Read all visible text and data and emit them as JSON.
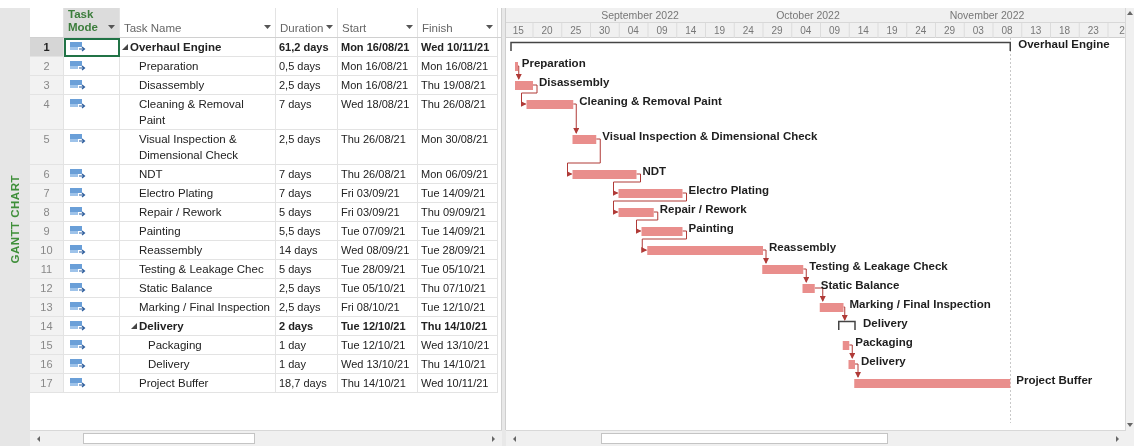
{
  "side_label": "GANTT CHART",
  "columns": [
    "Task Mode",
    "Task Name",
    "Duration",
    "Start",
    "Finish"
  ],
  "timescale": {
    "months": [
      "September 2022",
      "October 2022",
      "November 2022"
    ],
    "days": [
      "15",
      "20",
      "25",
      "30",
      "04",
      "09",
      "14",
      "19",
      "24",
      "29",
      "04",
      "09",
      "14",
      "19",
      "24",
      "29",
      "03",
      "08",
      "13",
      "18",
      "23",
      "2"
    ]
  },
  "rows": [
    {
      "id": "1",
      "name": "Overhaul Engine",
      "kind": "summary",
      "expanded": true,
      "selected": true,
      "duration": "61,2 days",
      "start": "Mon 16/08/21",
      "finish": "Wed 10/11/21",
      "bar_label": "Overhaul Engine",
      "children": [
        {
          "id": "2",
          "name": "Preparation",
          "kind": "task",
          "selected": false,
          "duration": "0,5 days",
          "start": "Mon 16/08/21",
          "finish": "Mon 16/08/21",
          "bar_label": "Preparation"
        },
        {
          "id": "3",
          "name": "Disassembly",
          "kind": "task",
          "selected": false,
          "duration": "2,5 days",
          "start": "Mon 16/08/21",
          "finish": "Thu 19/08/21",
          "bar_label": "Disassembly"
        },
        {
          "id": "4",
          "name": "Cleaning & Removal Paint",
          "kind": "task",
          "selected": false,
          "duration": "7 days",
          "start": "Wed 18/08/21",
          "finish": "Thu 26/08/21",
          "bar_label": "Cleaning & Removal Paint"
        },
        {
          "id": "5",
          "name": "Visual Inspection & Dimensional Check",
          "kind": "task",
          "selected": false,
          "duration": "2,5 days",
          "start": "Thu 26/08/21",
          "finish": "Mon 30/08/21",
          "bar_label": "Visual Inspection & Dimensional Check"
        },
        {
          "id": "6",
          "name": "NDT",
          "kind": "task",
          "selected": false,
          "duration": "7 days",
          "start": "Thu 26/08/21",
          "finish": "Mon 06/09/21",
          "bar_label": "NDT"
        },
        {
          "id": "7",
          "name": "Electro Plating",
          "kind": "task",
          "selected": false,
          "duration": "7 days",
          "start": "Fri 03/09/21",
          "finish": "Tue 14/09/21",
          "bar_label": "Electro Plating"
        },
        {
          "id": "8",
          "name": "Repair / Rework",
          "kind": "task",
          "selected": false,
          "duration": "5 days",
          "start": "Fri 03/09/21",
          "finish": "Thu 09/09/21",
          "bar_label": "Repair / Rework"
        },
        {
          "id": "9",
          "name": "Painting",
          "kind": "task",
          "selected": false,
          "duration": "5,5 days",
          "start": "Tue 07/09/21",
          "finish": "Tue 14/09/21",
          "bar_label": "Painting"
        },
        {
          "id": "10",
          "name": "Reassembly",
          "kind": "task",
          "selected": false,
          "duration": "14 days",
          "start": "Wed 08/09/21",
          "finish": "Tue 28/09/21",
          "bar_label": "Reassembly"
        },
        {
          "id": "11",
          "name": "Testing & Leakage Chec",
          "kind": "task",
          "selected": false,
          "duration": "5 days",
          "start": "Tue 28/09/21",
          "finish": "Tue 05/10/21",
          "bar_label": "Testing & Leakage Check"
        },
        {
          "id": "12",
          "name": "Static Balance",
          "kind": "task",
          "selected": false,
          "duration": "2,5 days",
          "start": "Tue 05/10/21",
          "finish": "Thu 07/10/21",
          "bar_label": "Static Balance"
        },
        {
          "id": "13",
          "name": "Marking / Final Inspection",
          "kind": "task",
          "selected": false,
          "duration": "2,5 days",
          "start": "Fri 08/10/21",
          "finish": "Tue 12/10/21",
          "bar_label": "Marking / Final Inspection"
        },
        {
          "id": "14",
          "name": "Delivery",
          "kind": "summary",
          "expanded": true,
          "selected": false,
          "duration": "2 days",
          "start": "Tue 12/10/21",
          "finish": "Thu 14/10/21",
          "bar_label": "Delivery",
          "children": [
            {
              "id": "15",
              "name": "Packaging",
              "kind": "task",
              "selected": false,
              "duration": "1 day",
              "start": "Tue 12/10/21",
              "finish": "Wed 13/10/21",
              "bar_label": "Packaging"
            },
            {
              "id": "16",
              "name": "Delivery",
              "kind": "task",
              "selected": false,
              "duration": "1 day",
              "start": "Wed 13/10/21",
              "finish": "Thu 14/10/21",
              "bar_label": "Delivery"
            }
          ]
        },
        {
          "id": "17",
          "name": "Project Buffer",
          "kind": "task",
          "selected": false,
          "duration": "18,7 days",
          "start": "Thu 14/10/21",
          "finish": "Wed 10/11/21",
          "bar_label": "Project Buffer"
        }
      ]
    }
  ]
}
